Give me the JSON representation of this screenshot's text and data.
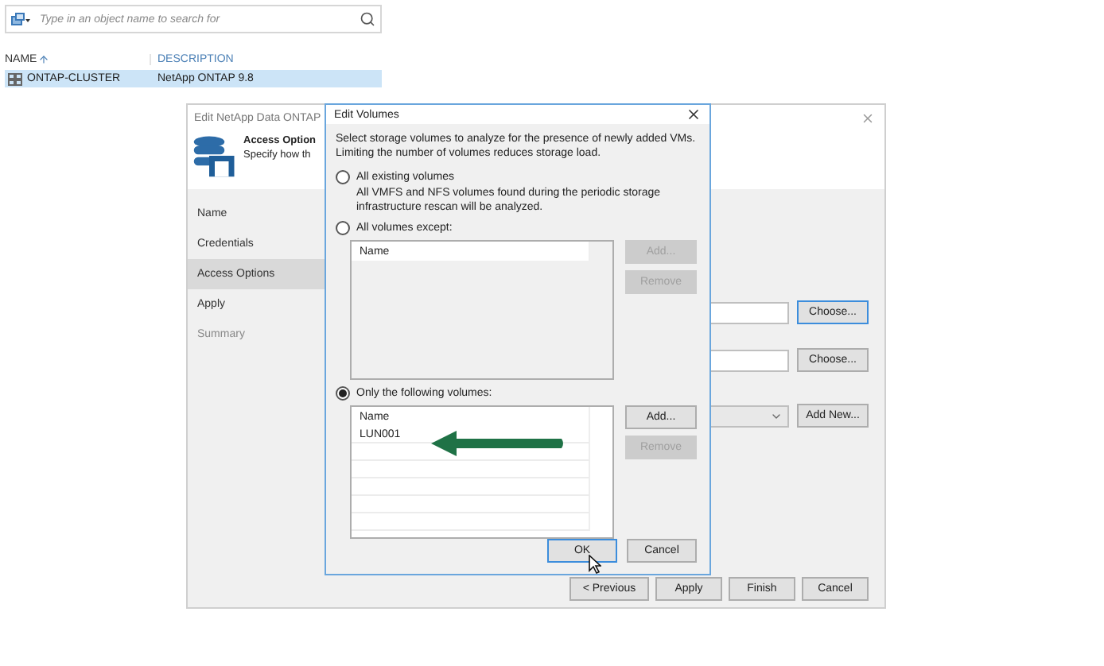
{
  "search": {
    "placeholder": "Type in an object name to search for"
  },
  "table": {
    "columns": [
      {
        "label": "NAME",
        "sorted": true
      },
      {
        "label": "DESCRIPTION",
        "sorted": false
      }
    ],
    "rows": [
      {
        "cells": [
          "ONTAP-CLUSTER",
          "NetApp ONTAP 9.8"
        ],
        "selected": true
      }
    ]
  },
  "wizard": {
    "title": "Edit NetApp Data ONTAP",
    "header": {
      "title": "Access Option",
      "subtitle": "Specify how th"
    },
    "steps": [
      {
        "label": "Name",
        "selected": false,
        "disabled": false
      },
      {
        "label": "Credentials",
        "selected": false,
        "disabled": false
      },
      {
        "label": "Access Options",
        "selected": true,
        "disabled": false
      },
      {
        "label": "Apply",
        "selected": false,
        "disabled": false
      },
      {
        "label": "Summary",
        "selected": false,
        "disabled": true
      }
    ],
    "fields": [
      {
        "kind": "text",
        "button": "Choose...",
        "focused": true
      },
      {
        "kind": "text",
        "button": "Choose...",
        "focused": false
      },
      {
        "kind": "dropdown",
        "button": "Add New...",
        "focused": false
      }
    ],
    "buttons": [
      "< Previous",
      "Apply",
      "Finish",
      "Cancel"
    ]
  },
  "dialog": {
    "title": "Edit Volumes",
    "intro": "Select storage volumes to analyze for the presence of newly added VMs. Limiting the number of volumes reduces storage load.",
    "options": [
      {
        "kind": "text",
        "label": "All existing volumes",
        "selected": false,
        "description": "All VMFS and NFS volumes found during the periodic storage infrastructure rescan will be analyzed."
      },
      {
        "kind": "list",
        "label": "All volumes except:",
        "selected": false,
        "column": "Name",
        "buttons": [
          {
            "label": "Add...",
            "disabled": true
          },
          {
            "label": "Remove",
            "disabled": true
          }
        ]
      },
      {
        "kind": "list",
        "label": "Only the following volumes:",
        "selected": true,
        "column": "Name",
        "items": [
          "LUN001"
        ],
        "buttons": [
          {
            "label": "Add...",
            "disabled": false
          },
          {
            "label": "Remove",
            "disabled": true
          }
        ]
      }
    ],
    "buttons": [
      {
        "label": "OK",
        "default": true
      },
      {
        "label": "Cancel",
        "default": false
      }
    ]
  }
}
